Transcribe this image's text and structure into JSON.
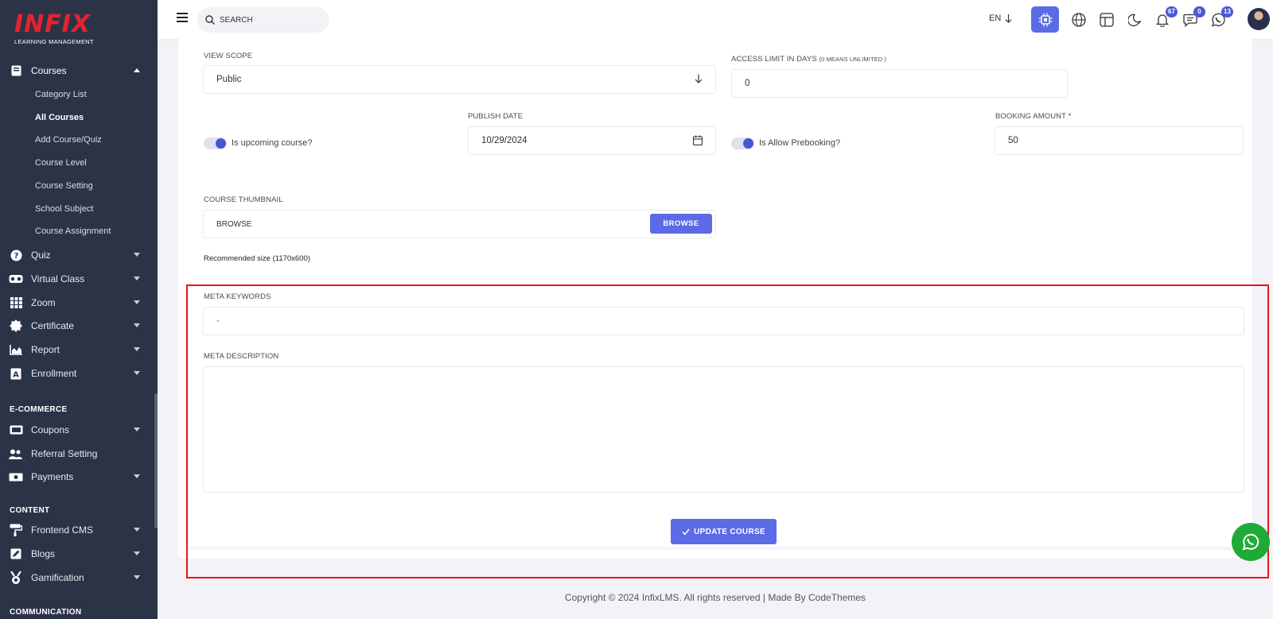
{
  "brand": {
    "logo_text": "INFIX",
    "logo_sub": "LEARNING MANAGEMENT",
    "accent": "#5b6be6",
    "logo_color": "#e5232e",
    "sidebar_bg": "#2b3447"
  },
  "sidebar": {
    "courses_label": "Courses",
    "course_subitems": [
      "Category List",
      "All Courses",
      "Add Course/Quiz",
      "Course Level",
      "Course Setting",
      "School Subject",
      "Course Assignment"
    ],
    "items": [
      {
        "label": "Quiz",
        "icon": "question-circle-icon"
      },
      {
        "label": "Virtual Class",
        "icon": "vr-headset-icon"
      },
      {
        "label": "Zoom",
        "icon": "grid-icon"
      },
      {
        "label": "Certificate",
        "icon": "certificate-icon"
      },
      {
        "label": "Report",
        "icon": "chart-area-icon"
      },
      {
        "label": "Enrollment",
        "icon": "enrollment-icon"
      }
    ],
    "ecommerce_label": "E-COMMERCE",
    "ecommerce_items": [
      "Coupons",
      "Referral Setting",
      "Payments"
    ],
    "content_label": "CONTENT",
    "content_items": [
      "Frontend CMS",
      "Blogs",
      "Gamification"
    ],
    "communication_label": "COMMUNICATION"
  },
  "topbar": {
    "search_placeholder": "SEARCH",
    "language": "EN",
    "notifications_count": "67",
    "messages_count": "0",
    "whatsapp_count": "13"
  },
  "form": {
    "view_scope_label": "VIEW SCOPE",
    "view_scope_value": "Public",
    "access_limit_label": "ACCESS LIMIT IN DAYS",
    "access_limit_note": "(0 MEANS UNLIMITED )",
    "access_limit_value": "0",
    "upcoming_label": "Is upcoming course?",
    "publish_date_label": "PUBLISH DATE",
    "publish_date_value": "10/29/2024",
    "prebooking_label": "Is Allow Prebooking?",
    "booking_amount_label": "BOOKING AMOUNT *",
    "booking_amount_value": "50",
    "thumbnail_label": "COURSE THUMBNAIL",
    "thumbnail_placeholder": "BROWSE",
    "browse_button": "BROWSE",
    "recommended_size": "Recommended size (1170x600)",
    "meta_keywords_label": "META KEYWORDS",
    "meta_keywords_value": "-",
    "meta_description_label": "META DESCRIPTION",
    "meta_description_value": "",
    "update_button": "UPDATE COURSE"
  },
  "footer": {
    "copyright": "Copyright © 2024 InfixLMS. All rights reserved | Made By CodeThemes"
  }
}
